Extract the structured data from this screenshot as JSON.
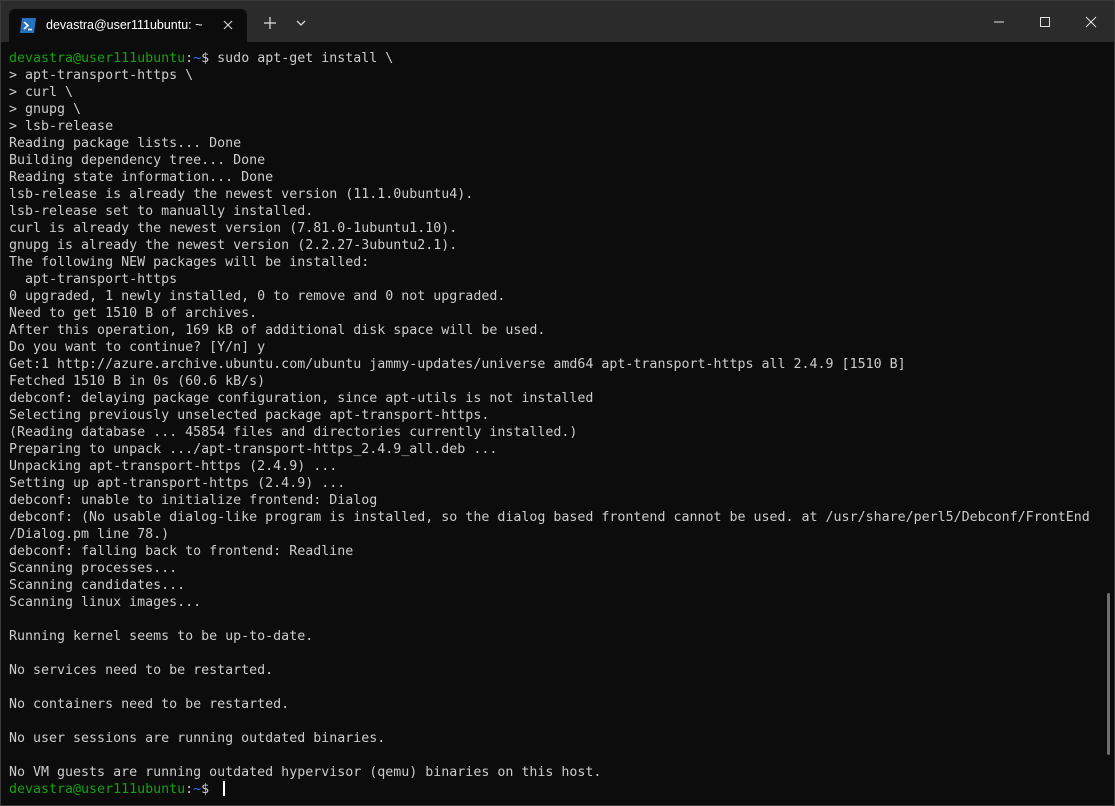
{
  "window": {
    "tab_title": "devastra@user111ubuntu: ~",
    "colors": {
      "background": "#0c0c0c",
      "titlebar": "#2b2b2b",
      "text": "#cccccc",
      "prompt_user": "#13a10e",
      "prompt_path": "#3b78ff"
    },
    "icons": {
      "tab": "powershell-icon",
      "tab_close": "close-icon",
      "new_tab": "plus-icon",
      "dropdown": "chevron-down-icon",
      "minimize": "minimize-icon",
      "maximize": "maximize-icon",
      "close": "close-icon"
    }
  },
  "terminal": {
    "prompt": {
      "user_host": "devastra@user111ubuntu",
      "separator": ":",
      "path": "~",
      "symbol": "$ "
    },
    "command": "sudo apt-get install \\",
    "output_lines": [
      "> apt-transport-https \\",
      "> curl \\",
      "> gnupg \\",
      "> lsb-release",
      "Reading package lists... Done",
      "Building dependency tree... Done",
      "Reading state information... Done",
      "lsb-release is already the newest version (11.1.0ubuntu4).",
      "lsb-release set to manually installed.",
      "curl is already the newest version (7.81.0-1ubuntu1.10).",
      "gnupg is already the newest version (2.2.27-3ubuntu2.1).",
      "The following NEW packages will be installed:",
      "  apt-transport-https",
      "0 upgraded, 1 newly installed, 0 to remove and 0 not upgraded.",
      "Need to get 1510 B of archives.",
      "After this operation, 169 kB of additional disk space will be used.",
      "Do you want to continue? [Y/n] y",
      "Get:1 http://azure.archive.ubuntu.com/ubuntu jammy-updates/universe amd64 apt-transport-https all 2.4.9 [1510 B]",
      "Fetched 1510 B in 0s (60.6 kB/s)",
      "debconf: delaying package configuration, since apt-utils is not installed",
      "Selecting previously unselected package apt-transport-https.",
      "(Reading database ... 45854 files and directories currently installed.)",
      "Preparing to unpack .../apt-transport-https_2.4.9_all.deb ...",
      "Unpacking apt-transport-https (2.4.9) ...",
      "Setting up apt-transport-https (2.4.9) ...",
      "debconf: unable to initialize frontend: Dialog",
      "debconf: (No usable dialog-like program is installed, so the dialog based frontend cannot be used. at /usr/share/perl5/Debconf/FrontEnd",
      "/Dialog.pm line 78.)",
      "debconf: falling back to frontend: Readline",
      "Scanning processes...",
      "Scanning candidates...",
      "Scanning linux images...",
      "",
      "Running kernel seems to be up-to-date.",
      "",
      "No services need to be restarted.",
      "",
      "No containers need to be restarted.",
      "",
      "No user sessions are running outdated binaries.",
      "",
      "No VM guests are running outdated hypervisor (qemu) binaries on this host."
    ]
  }
}
